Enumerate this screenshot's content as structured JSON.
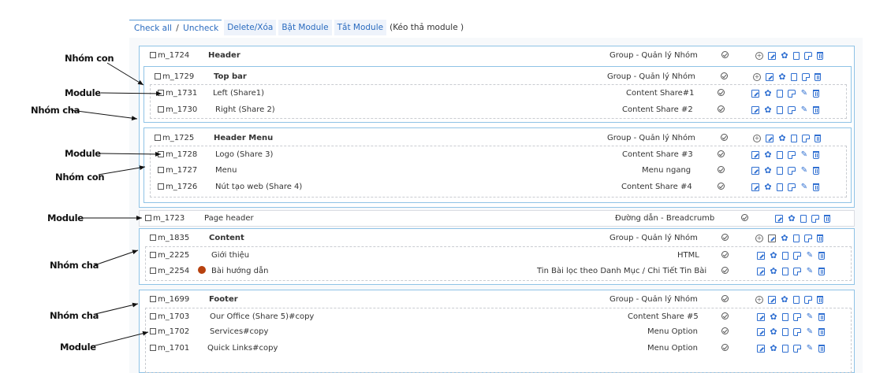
{
  "toolbar": {
    "check_all": "Check all",
    "slash": "/",
    "uncheck": "Uncheck",
    "delete": "Delete/Xóa",
    "enable_module": "Bật Module",
    "disable_module": "Tắt Module",
    "drag_hint": "(Kéo thả module )"
  },
  "annotations": {
    "group_child_1": "Nhóm con",
    "module_1": "Module",
    "group_parent_1": "Nhóm cha",
    "module_2": "Module",
    "group_child_2": "Nhóm con",
    "module_3": "Module",
    "group_parent_2": "Nhóm cha",
    "group_parent_3": "Nhóm cha",
    "module_4": "Module"
  },
  "rows": {
    "r1724": {
      "id": "m_1724",
      "name": "Header",
      "type": "Group - Quản lý Nhóm"
    },
    "r1729": {
      "id": "m_1729",
      "name": "Top bar",
      "type": "Group - Quản lý Nhóm"
    },
    "r1731": {
      "id": "m_1731",
      "name": "Left (Share1)",
      "type": "Content Share#1"
    },
    "r1730": {
      "id": "m_1730",
      "name": "Right (Share 2)",
      "type": "Content Share #2"
    },
    "r1725": {
      "id": "m_1725",
      "name": "Header Menu",
      "type": "Group - Quản lý Nhóm"
    },
    "r1728": {
      "id": "m_1728",
      "name": "Logo (Share 3)",
      "type": "Content Share #3"
    },
    "r1727": {
      "id": "m_1727",
      "name": "Menu",
      "type": "Menu ngang"
    },
    "r1726": {
      "id": "m_1726",
      "name": "Nút tạo web (Share 4)",
      "type": "Content Share #4"
    },
    "r1723": {
      "id": "m_1723",
      "name": "Page header",
      "type": "Đường dẫn - Breadcrumb"
    },
    "r1835": {
      "id": "m_1835",
      "name": "Content",
      "type": "Group - Quản lý Nhóm"
    },
    "r2225": {
      "id": "m_2225",
      "name": "Giới thiệu",
      "type": "HTML"
    },
    "r2254": {
      "id": "m_2254",
      "name": "Bài hướng dẫn",
      "type": "Tin Bài lọc theo Danh Mục / Chi Tiết Tin Bài"
    },
    "r1699": {
      "id": "m_1699",
      "name": "Footer",
      "type": "Group - Quản lý Nhóm"
    },
    "r1703": {
      "id": "m_1703",
      "name": "Our Office (Share 5)#copy",
      "type": "Content Share #5"
    },
    "r1702": {
      "id": "m_1702",
      "name": "Services#copy",
      "type": "Menu Option"
    },
    "r1701": {
      "id": "m_1701",
      "name": "Quick Links#copy",
      "type": "Menu Option"
    }
  },
  "colors": {
    "link": "#2a6bbf",
    "icon": "#2f6fd1",
    "box_border": "#8fc3e6",
    "status_dot": "#b7410e"
  }
}
